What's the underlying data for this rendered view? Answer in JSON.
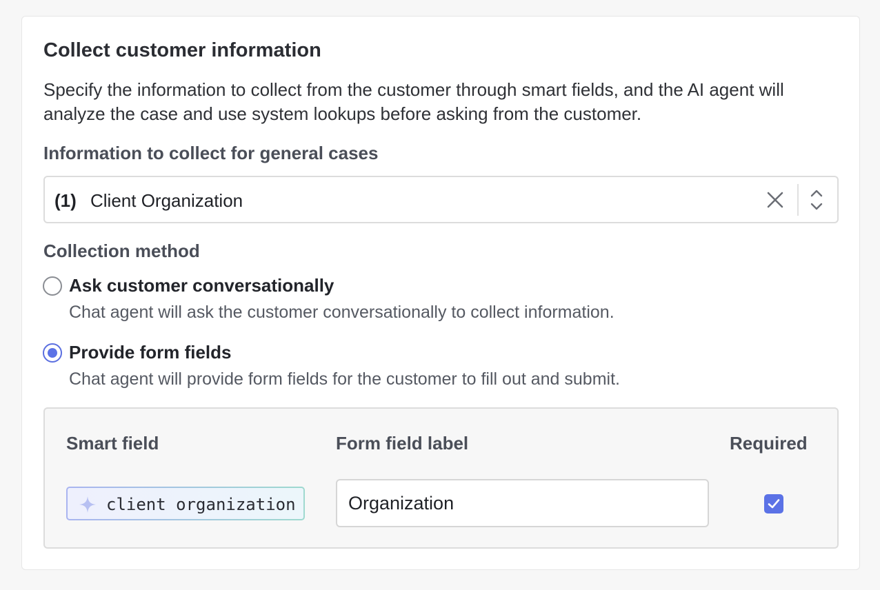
{
  "title": "Collect customer information",
  "description": "Specify the information to collect from the customer through smart fields, and the AI agent will analyze the case and use system lookups before asking from the customer.",
  "collect_section": {
    "label": "Information to collect for general cases",
    "count": "(1)",
    "selected_value": "Client Organization",
    "clear_icon": "close-icon",
    "toggle_icon": "chevron-up-down-icon"
  },
  "method_section": {
    "label": "Collection method",
    "options": [
      {
        "label": "Ask customer conversationally",
        "help": "Chat agent will ask the customer conversationally to collect information.",
        "selected": false
      },
      {
        "label": "Provide form fields",
        "help": "Chat agent will provide form fields for the customer to fill out and submit.",
        "selected": true
      }
    ]
  },
  "fields_table": {
    "headers": {
      "smart_field": "Smart field",
      "form_field_label": "Form field label",
      "required": "Required"
    },
    "rows": [
      {
        "smart_field": "client organization",
        "smart_field_icon": "sparkle-icon",
        "form_field_label": "Organization",
        "required": true
      }
    ]
  },
  "colors": {
    "accent": "#5b72e6",
    "text_primary": "#2b2d33",
    "text_secondary": "#555962"
  }
}
